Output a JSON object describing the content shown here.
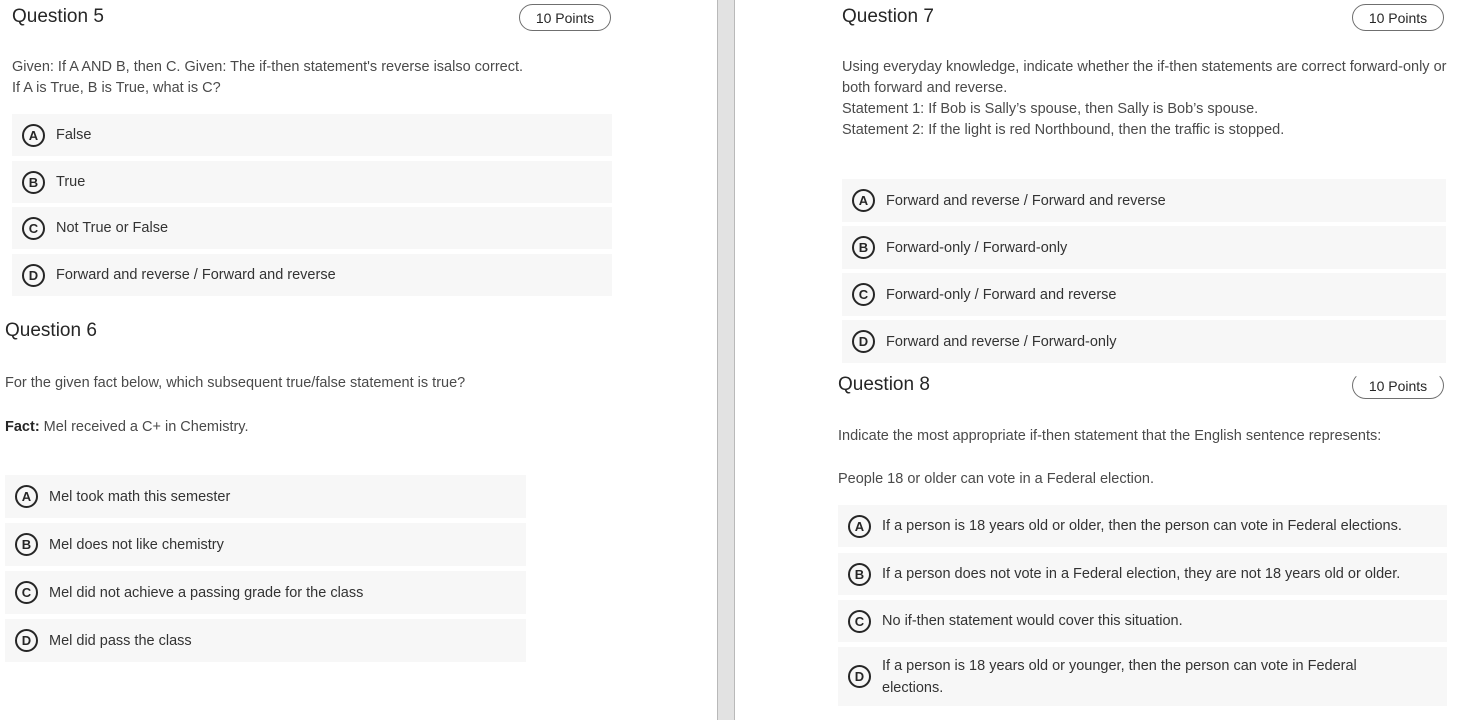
{
  "questions": {
    "q5": {
      "title": "Question 5",
      "points": "10 Points",
      "prompt_lines": [
        "Given: If A AND B, then C. Given: The if-then statement's reverse isalso correct.",
        "If A is True, B is True, what is C?"
      ],
      "options": [
        {
          "letter": "A",
          "text": "False"
        },
        {
          "letter": "B",
          "text": "True"
        },
        {
          "letter": "C",
          "text": "Not True or False"
        },
        {
          "letter": "D",
          "text": "Forward and reverse / Forward and reverse"
        }
      ]
    },
    "q6": {
      "title": "Question 6",
      "prompt": "For the given fact below, which subsequent true/false statement is true?",
      "fact_label": "Fact:",
      "fact_text": " Mel received a C+ in Chemistry.",
      "options": [
        {
          "letter": "A",
          "text": "Mel took math this semester"
        },
        {
          "letter": "B",
          "text": "Mel does not like chemistry"
        },
        {
          "letter": "C",
          "text": "Mel did not achieve a passing grade for the class"
        },
        {
          "letter": "D",
          "text": "Mel did pass the class"
        }
      ]
    },
    "q7": {
      "title": "Question 7",
      "points": "10 Points",
      "prompt_lines": [
        "Using everyday knowledge, indicate whether the if-then statements are correct forward-only or",
        "both forward and reverse.",
        "Statement 1: If Bob is Sally’s spouse, then Sally is Bob’s spouse.",
        "Statement 2: If the light is red Northbound, then the traffic is stopped."
      ],
      "options": [
        {
          "letter": "A",
          "text": "Forward and reverse / Forward and reverse"
        },
        {
          "letter": "B",
          "text": "Forward-only / Forward-only"
        },
        {
          "letter": "C",
          "text": "Forward-only / Forward and reverse"
        },
        {
          "letter": "D",
          "text": "Forward and reverse / Forward-only"
        }
      ]
    },
    "q8": {
      "title": "Question 8",
      "points": "10 Points",
      "prompt": "Indicate the most appropriate if-then statement that the English sentence represents:",
      "sentence": "People 18 or older can vote in a Federal election.",
      "options": [
        {
          "letter": "A",
          "text": "If a person is 18 years old or older, then the person can vote in Federal elections."
        },
        {
          "letter": "B",
          "text": "If a person does not vote in a Federal election, they are not 18 years old or older."
        },
        {
          "letter": "C",
          "text": "No if-then statement would cover this situation."
        },
        {
          "letter": "D",
          "text": "If a person is 18 years old or younger, then the person can vote in Federal elections."
        }
      ]
    }
  }
}
